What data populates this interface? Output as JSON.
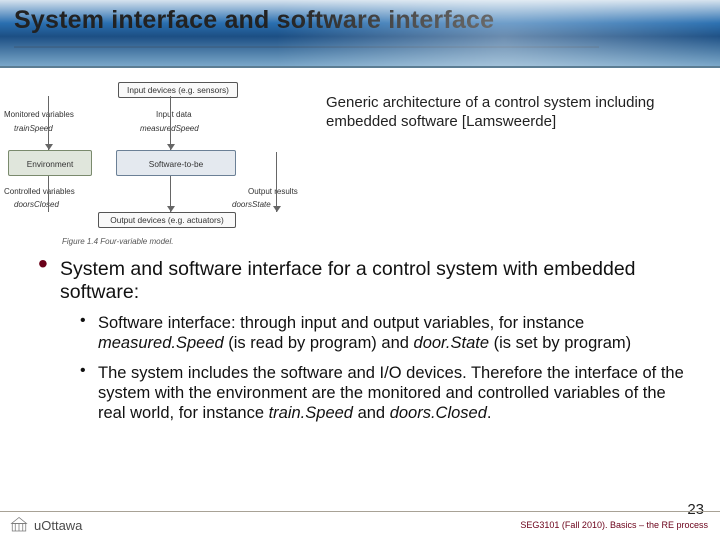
{
  "title": "System interface and software interface",
  "diagram": {
    "input_devices": "Input devices (e.g. sensors)",
    "output_devices": "Output devices (e.g. actuators)",
    "environment": "Environment",
    "software": "Software-to-be",
    "labels": {
      "monitored": "Monitored variables",
      "controlled": "Controlled variables",
      "input_data": "Input data",
      "output_results": "Output results"
    },
    "vars": {
      "trainSpeed": "trainSpeed",
      "measuredSpeed": "measuredSpeed",
      "doorsClosed": "doorsClosed",
      "doorsState": "doorsState"
    },
    "figure_caption": "Figure 1.4   Four-variable model."
  },
  "side_caption": "Generic architecture of a control system including embedded software [Lamsweerde]",
  "bullets": {
    "main": "System and software interface for a control system with embedded software:",
    "sub1_a": "Software interface: through input and output variables, for instance ",
    "sub1_b": " (is read by program) and ",
    "sub1_c": " (is set by program)",
    "var_ms": "measured.Speed",
    "var_ds": "door.State",
    "sub2_a": "The system includes the software and I/O devices. Therefore the interface of the system with the environment are the monitored and controlled variables of the real world, for instance ",
    "sub2_b": " and ",
    "var_ts": "train.Speed",
    "var_dc": "doors.Closed",
    "period": "."
  },
  "footer": {
    "logo_text": "uOttawa",
    "course": "SEG3101 (Fall 2010).   Basics – the RE process",
    "page": "23"
  }
}
